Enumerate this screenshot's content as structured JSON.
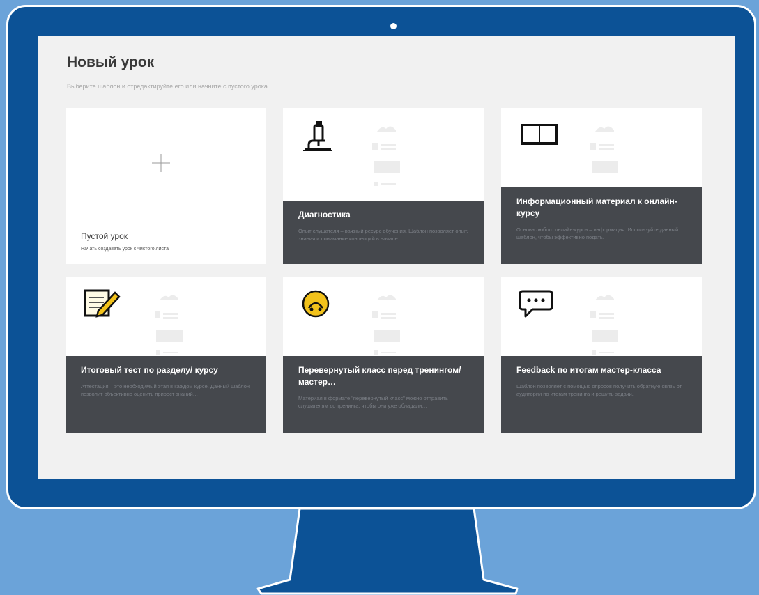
{
  "page": {
    "title": "Новый урок",
    "subtitle": "Выберите шаблон и отредактируйте его или начните с пустого урока"
  },
  "cards": [
    {
      "title": "Пустой урок",
      "description": "Начать создавать урок с чистого листа",
      "icon": "plus-icon"
    },
    {
      "title": "Диагностика",
      "description": "Опыт слушателя – важный ресурс обучения. Шаблон позволяет опыт, знания и понимание концепций в начале.",
      "icon": "microscope-icon"
    },
    {
      "title": "Информационный материал к онлайн-курсу",
      "description": "Основа любого онлайн-курса – информация. Используйте данный шаблон, чтобы эффективно подать.",
      "icon": "book-icon"
    },
    {
      "title": "Итоговый тест по разделу/ курсу",
      "description": "Аттестация – это необходимый этап в каждом курсе. Данный шаблон позволит объективно оценить прирост знаний…",
      "icon": "notepad-pencil-icon"
    },
    {
      "title": "Перевернутый класс перед тренингом/мастер…",
      "description": "Материал в формате \"перевернутый класс\" можно отправить слушателям до тренинга, чтобы они уже обладали…",
      "icon": "upside-down-face-icon"
    },
    {
      "title": "Feedback по итогам мастер-класса",
      "description": "Шаблон позволяет с помощью опросов получить обратную связь от аудитории по итогам тренинга и решить задачи.",
      "icon": "speech-bubble-icon"
    }
  ],
  "colors": {
    "background": "#6ba3d9",
    "monitor_frame": "#0c5296",
    "screen": "#f1f1f1",
    "card_footer": "#45484d",
    "icon_yellow": "#f2c21b"
  }
}
